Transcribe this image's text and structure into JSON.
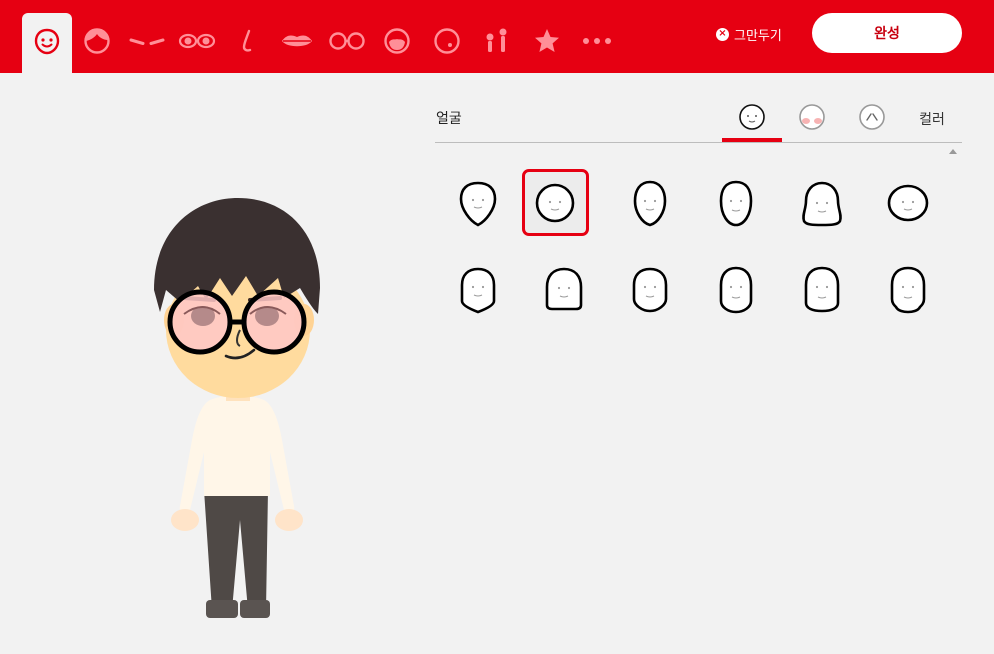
{
  "topbar": {
    "categories": [
      {
        "name": "face",
        "icon": "face-icon",
        "active": true
      },
      {
        "name": "hair",
        "icon": "hair-icon"
      },
      {
        "name": "eyebrows",
        "icon": "eyebrows-icon"
      },
      {
        "name": "eyes",
        "icon": "eyes-icon"
      },
      {
        "name": "nose",
        "icon": "nose-icon"
      },
      {
        "name": "mouth",
        "icon": "mouth-icon"
      },
      {
        "name": "glasses",
        "icon": "glasses-icon"
      },
      {
        "name": "beard",
        "icon": "beard-icon"
      },
      {
        "name": "mole",
        "icon": "mole-icon"
      },
      {
        "name": "body",
        "icon": "body-icon"
      },
      {
        "name": "favorite",
        "icon": "star-icon"
      },
      {
        "name": "more",
        "icon": "more-icon"
      }
    ],
    "quit_label": "그만두기",
    "done_label": "완성",
    "accent": "#e60012"
  },
  "panel": {
    "title": "얼굴",
    "subtabs": [
      {
        "name": "shape",
        "icon": "face-shape-icon",
        "active": true
      },
      {
        "name": "makeup",
        "icon": "blush-icon"
      },
      {
        "name": "wrinkles",
        "icon": "wrinkle-icon"
      }
    ],
    "color_label": "컬러",
    "selected_index": 1,
    "shape_count": 12
  }
}
